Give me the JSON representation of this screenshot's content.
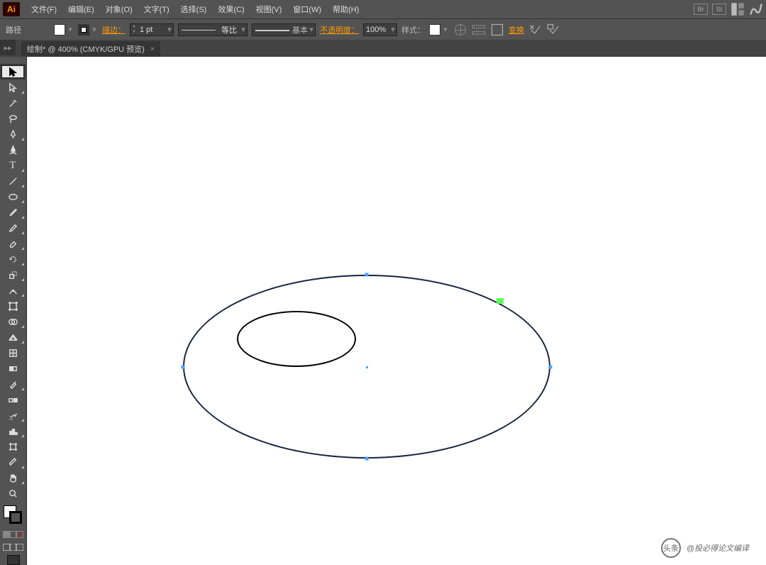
{
  "app": {
    "logo": "Ai"
  },
  "menu": {
    "items": [
      {
        "label": "文件(F)"
      },
      {
        "label": "编辑(E)"
      },
      {
        "label": "对象(O)"
      },
      {
        "label": "文字(T)"
      },
      {
        "label": "选择(S)"
      },
      {
        "label": "效果(C)"
      },
      {
        "label": "视图(V)"
      },
      {
        "label": "窗口(W)"
      },
      {
        "label": "帮助(H)"
      }
    ],
    "br_label": "Br",
    "st_label": "St"
  },
  "control": {
    "path_label": "路径",
    "stroke_label": "描边：",
    "stroke_weight": "1 pt",
    "profile_label": "等比",
    "brush_label": "基本",
    "opacity_label": "不透明度：",
    "opacity_value": "100%",
    "style_label": "样式：",
    "transform_label": "变换"
  },
  "document": {
    "tab_title": "绘制* @ 400% (CMYK/GPU 预览)",
    "close_x": "×"
  },
  "tools": {
    "list": [
      {
        "name": "selection-tool",
        "selected": true
      },
      {
        "name": "direct-selection-tool"
      },
      {
        "name": "magic-wand-tool"
      },
      {
        "name": "lasso-tool"
      },
      {
        "name": "pen-tool"
      },
      {
        "name": "curvature-tool"
      },
      {
        "name": "type-tool"
      },
      {
        "name": "line-segment-tool"
      },
      {
        "name": "ellipse-tool"
      },
      {
        "name": "paintbrush-tool"
      },
      {
        "name": "pencil-tool"
      },
      {
        "name": "eraser-tool"
      },
      {
        "name": "rotate-tool"
      },
      {
        "name": "scale-tool"
      },
      {
        "name": "width-tool"
      },
      {
        "name": "free-transform-tool"
      },
      {
        "name": "shape-builder-tool"
      },
      {
        "name": "perspective-grid-tool"
      },
      {
        "name": "mesh-tool"
      },
      {
        "name": "gradient-tool"
      },
      {
        "name": "eyedropper-tool"
      },
      {
        "name": "blend-tool"
      },
      {
        "name": "symbol-sprayer-tool"
      },
      {
        "name": "column-graph-tool"
      },
      {
        "name": "artboard-tool"
      },
      {
        "name": "slice-tool"
      },
      {
        "name": "hand-tool"
      },
      {
        "name": "zoom-tool"
      }
    ]
  },
  "watermark": {
    "prefix": "头条",
    "text": "@投必得论文编译"
  }
}
